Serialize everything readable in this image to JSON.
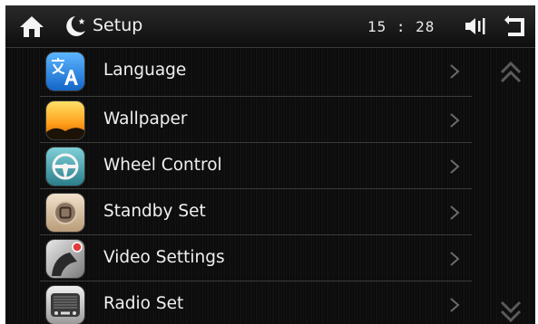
{
  "header": {
    "title": "Setup",
    "time": "15 : 28",
    "icons": [
      "home-icon",
      "night-mode-icon",
      "volume-icon",
      "back-icon"
    ]
  },
  "menu": {
    "items": [
      {
        "label": "Language",
        "icon": "language-icon"
      },
      {
        "label": "Wallpaper",
        "icon": "wallpaper-icon"
      },
      {
        "label": "Wheel Control",
        "icon": "steering-wheel-icon"
      },
      {
        "label": "Standby Set",
        "icon": "standby-icon"
      },
      {
        "label": "Video Settings",
        "icon": "video-settings-icon"
      },
      {
        "label": "Radio Set",
        "icon": "radio-icon"
      }
    ]
  },
  "scroll": {
    "up_icon": "double-chevron-up-icon",
    "down_icon": "double-chevron-down-icon"
  },
  "colors": {
    "background": "#0c0c0c",
    "text": "#f0f0f0",
    "chevron": "#6a6a6a",
    "divider": "#3c3c3c"
  }
}
